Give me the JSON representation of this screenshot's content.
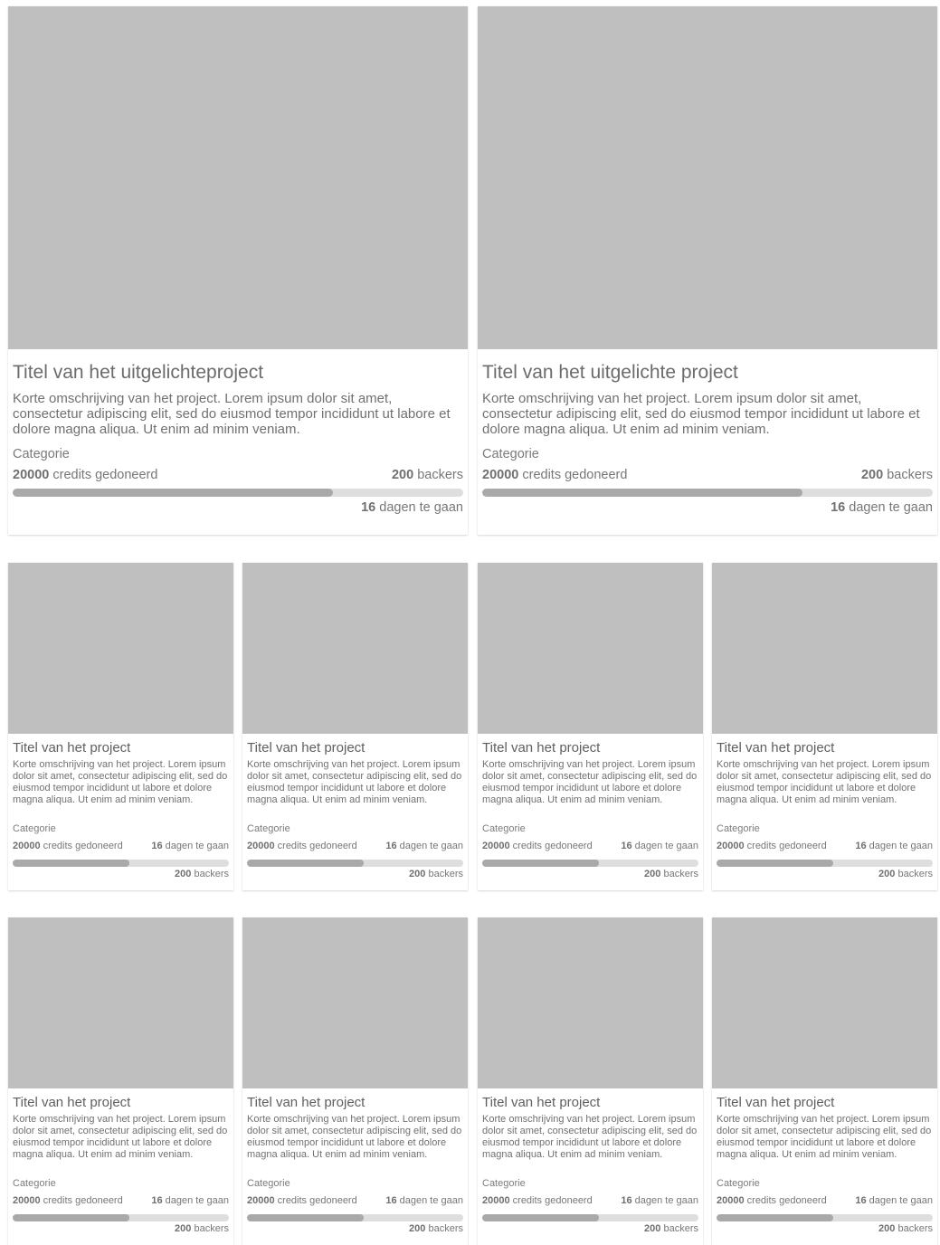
{
  "featured": [
    {
      "title": "Titel van het uitgelichteproject",
      "description": "Korte omschrijving van het project. Lorem ipsum dolor sit amet, consectetur adipiscing elit, sed do eiusmod tempor incididunt ut labore et dolore magna aliqua. Ut enim ad minim veniam.",
      "category": "Categorie",
      "credits_value": "20000",
      "credits_label": "credits gedoneerd",
      "backers_value": "200",
      "backers_label": "backers",
      "days_value": "16",
      "days_label": "dagen te gaan",
      "progress": 0.71
    },
    {
      "title": "Titel van het uitgelichte project",
      "description": "Korte omschrijving van het project. Lorem ipsum dolor sit amet, consectetur adipiscing elit, sed do eiusmod tempor incididunt ut labore et dolore magna aliqua. Ut enim ad minim veniam.",
      "category": "Categorie",
      "credits_value": "20000",
      "credits_label": "credits gedoneerd",
      "backers_value": "200",
      "backers_label": "backers",
      "days_value": "16",
      "days_label": "dagen te gaan",
      "progress": 0.71
    }
  ],
  "grid": [
    {
      "title": "Titel van het project",
      "description": "Korte omschrijving van het project. Lorem ipsum dolor sit amet, consectetur adipiscing elit, sed do eiusmod tempor incididunt ut labore et dolore magna aliqua. Ut enim ad minim veniam.",
      "category": "Categorie",
      "credits_value": "20000",
      "credits_label": "credits gedoneerd",
      "days_value": "16",
      "days_label": "dagen te gaan",
      "backers_value": "200",
      "backers_label": "backers",
      "progress": 0.54
    },
    {
      "title": "Titel van het project",
      "description": "Korte omschrijving van het project. Lorem ipsum dolor sit amet, consectetur adipiscing elit, sed do eiusmod tempor incididunt ut labore et dolore magna aliqua. Ut enim ad minim veniam.",
      "category": "Categorie",
      "credits_value": "20000",
      "credits_label": "credits gedoneerd",
      "days_value": "16",
      "days_label": "dagen te gaan",
      "backers_value": "200",
      "backers_label": "backers",
      "progress": 0.54
    },
    {
      "title": "Titel van het project",
      "description": "Korte omschrijving van het project. Lorem ipsum dolor sit amet, consectetur adipiscing elit, sed do eiusmod tempor incididunt ut labore et dolore magna aliqua. Ut enim ad minim veniam.",
      "category": "Categorie",
      "credits_value": "20000",
      "credits_label": "credits gedoneerd",
      "days_value": "16",
      "days_label": "dagen te gaan",
      "backers_value": "200",
      "backers_label": "backers",
      "progress": 0.54
    },
    {
      "title": "Titel van het project",
      "description": "Korte omschrijving van het project. Lorem ipsum dolor sit amet, consectetur adipiscing elit, sed do eiusmod tempor incididunt ut labore et dolore magna aliqua. Ut enim ad minim veniam.",
      "category": "Categorie",
      "credits_value": "20000",
      "credits_label": "credits gedoneerd",
      "days_value": "16",
      "days_label": "dagen te gaan",
      "backers_value": "200",
      "backers_label": "backers",
      "progress": 0.54
    },
    {
      "title": "Titel van het project",
      "description": "Korte omschrijving van het project. Lorem ipsum dolor sit amet, consectetur adipiscing elit, sed do eiusmod tempor incididunt ut labore et dolore magna aliqua. Ut enim ad minim veniam.",
      "category": "Categorie",
      "credits_value": "20000",
      "credits_label": "credits gedoneerd",
      "days_value": "16",
      "days_label": "dagen te gaan",
      "backers_value": "200",
      "backers_label": "backers",
      "progress": 0.54
    },
    {
      "title": "Titel van het project",
      "description": "Korte omschrijving van het project. Lorem ipsum dolor sit amet, consectetur adipiscing elit, sed do eiusmod tempor incididunt ut labore et dolore magna aliqua. Ut enim ad minim veniam.",
      "category": "Categorie",
      "credits_value": "20000",
      "credits_label": "credits gedoneerd",
      "days_value": "16",
      "days_label": "dagen te gaan",
      "backers_value": "200",
      "backers_label": "backers",
      "progress": 0.54
    },
    {
      "title": "Titel van het project",
      "description": "Korte omschrijving van het project. Lorem ipsum dolor sit amet, consectetur adipiscing elit, sed do eiusmod tempor incididunt ut labore et dolore magna aliqua. Ut enim ad minim veniam.",
      "category": "Categorie",
      "credits_value": "20000",
      "credits_label": "credits gedoneerd",
      "days_value": "16",
      "days_label": "dagen te gaan",
      "backers_value": "200",
      "backers_label": "backers",
      "progress": 0.54
    },
    {
      "title": "Titel van het project",
      "description": "Korte omschrijving van het project. Lorem ipsum dolor sit amet, consectetur adipiscing elit, sed do eiusmod tempor incididunt ut labore et dolore magna aliqua. Ut enim ad minim veniam.",
      "category": "Categorie",
      "credits_value": "20000",
      "credits_label": "credits gedoneerd",
      "days_value": "16",
      "days_label": "dagen te gaan",
      "backers_value": "200",
      "backers_label": "backers",
      "progress": 0.54
    }
  ],
  "colors": {
    "placeholder": "#bfbfbf",
    "progress_track": "#dedede",
    "progress_fill": "#a9a9a9",
    "text": "#6f6f6f"
  }
}
